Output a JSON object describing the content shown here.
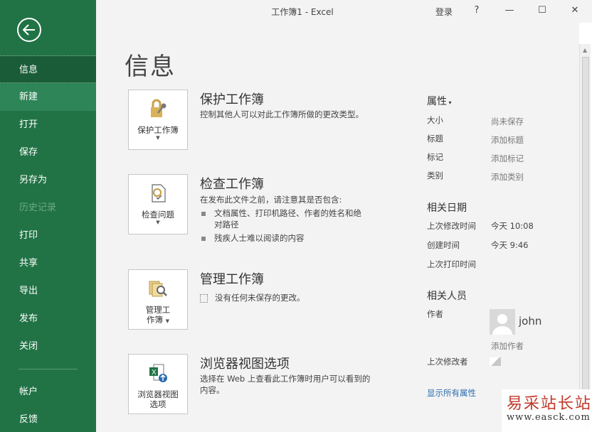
{
  "window": {
    "title": "工作簿1  -  Excel",
    "login": "登录",
    "help": "?",
    "minimize": "—",
    "maximize": "☐",
    "close": "✕"
  },
  "sidebar": {
    "items": [
      {
        "label": "信息",
        "state": "active"
      },
      {
        "label": "新建",
        "state": "hover"
      },
      {
        "label": "打开",
        "state": "normal"
      },
      {
        "label": "保存",
        "state": "normal"
      },
      {
        "label": "另存为",
        "state": "normal"
      },
      {
        "label": "历史记录",
        "state": "disabled"
      },
      {
        "label": "打印",
        "state": "normal"
      },
      {
        "label": "共享",
        "state": "normal"
      },
      {
        "label": "导出",
        "state": "normal"
      },
      {
        "label": "发布",
        "state": "normal"
      },
      {
        "label": "关闭",
        "state": "normal"
      }
    ],
    "bottom_items": [
      {
        "label": "帐户"
      },
      {
        "label": "反馈"
      }
    ]
  },
  "main": {
    "title": "信息",
    "sections": {
      "protect": {
        "button_label": "保护工作簿",
        "title": "保护工作簿",
        "desc": "控制其他人可以对此工作簿所做的更改类型。"
      },
      "inspect": {
        "button_label": "检查问题",
        "title": "检查工作簿",
        "desc": "在发布此文件之前，请注意其是否包含:",
        "bullets": [
          "文档属性、打印机路径、作者的姓名和绝对路径",
          "残疾人士难以阅读的内容"
        ]
      },
      "manage": {
        "button_label_1": "管理工",
        "button_label_2": "作簿",
        "title": "管理工作簿",
        "desc": "没有任何未保存的更改。"
      },
      "browser": {
        "button_label_1": "浏览器视图",
        "button_label_2": "选项",
        "title": "浏览器视图选项",
        "desc": "选择在 Web 上查看此工作簿时用户可以看到的内容。"
      }
    }
  },
  "properties": {
    "header": "属性",
    "rows": [
      {
        "label": "大小",
        "value": "尚未保存"
      },
      {
        "label": "标题",
        "value": "添加标题"
      },
      {
        "label": "标记",
        "value": "添加标记"
      },
      {
        "label": "类别",
        "value": "添加类别"
      }
    ],
    "dates_header": "相关日期",
    "dates": [
      {
        "label": "上次修改时间",
        "value": "今天 10:08"
      },
      {
        "label": "创建时间",
        "value": "今天 9:46"
      },
      {
        "label": "上次打印时间",
        "value": ""
      }
    ],
    "people_header": "相关人员",
    "author_label": "作者",
    "author_name": "john",
    "add_author": "添加作者",
    "last_modified_by_label": "上次修改者",
    "show_all": "显示所有属性"
  },
  "watermark": {
    "text": "易采站长站",
    "sub": "www.easck.com"
  }
}
